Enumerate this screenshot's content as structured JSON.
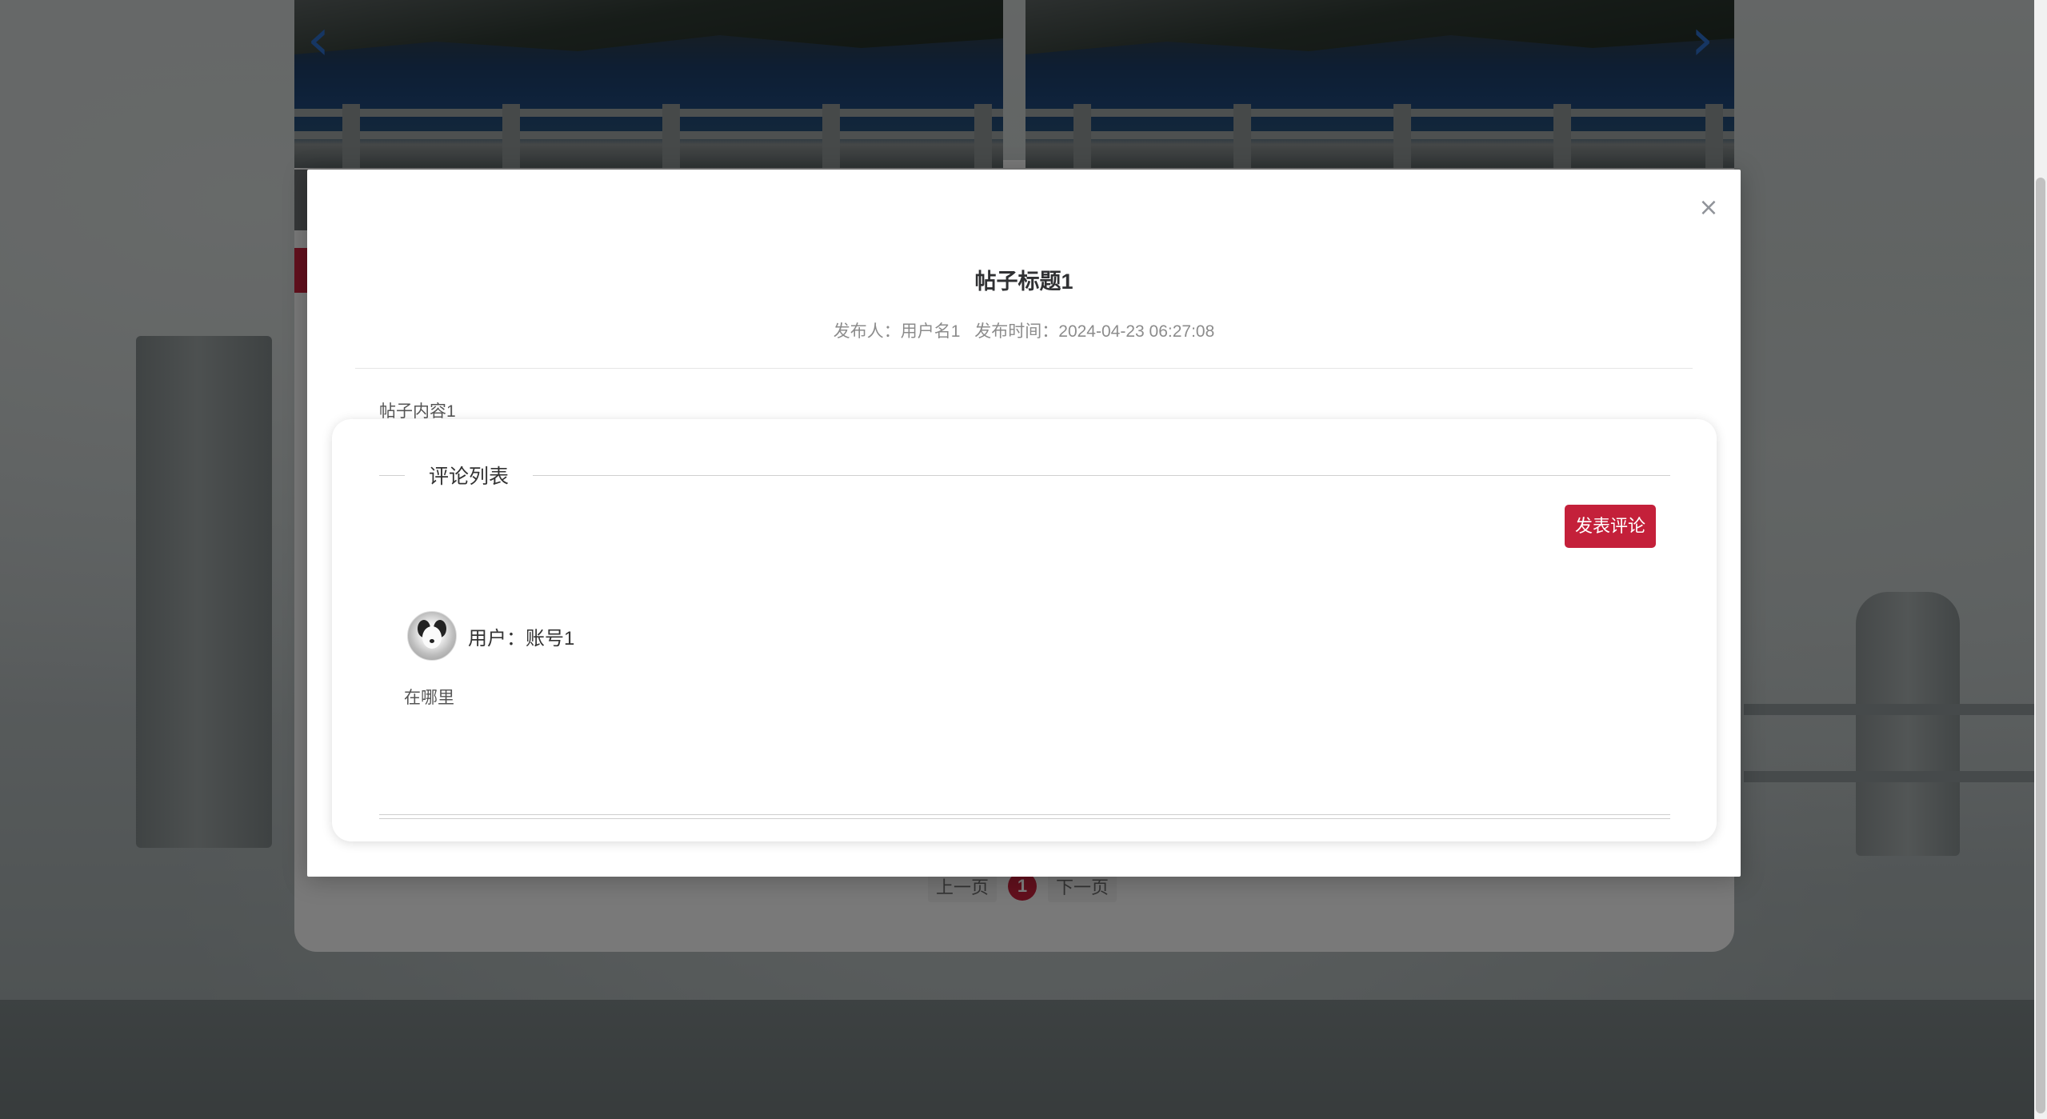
{
  "background": {
    "pager": {
      "prev_label": "上一页",
      "current_page": "1",
      "next_label": "下一页"
    },
    "carousel": {
      "prev_icon": "chevron-left-icon",
      "next_icon": "chevron-right-icon"
    }
  },
  "dialog": {
    "close_icon": "close-icon",
    "close_symbol": "×",
    "post_title": "帖子标题1",
    "meta": {
      "publisher_label": "发布人：用户名1",
      "time_label": "发布时间：2024-04-23 06:27:08"
    },
    "post_content": "帖子内容1",
    "comments": {
      "header_label": "评论列表",
      "post_button_label": "发表评论",
      "items": [
        {
          "user_label": "用户：账号1",
          "text": "在哪里"
        }
      ]
    }
  },
  "colors": {
    "accent": "#c4203a",
    "mask": "rgba(0,0,0,0.5)"
  }
}
